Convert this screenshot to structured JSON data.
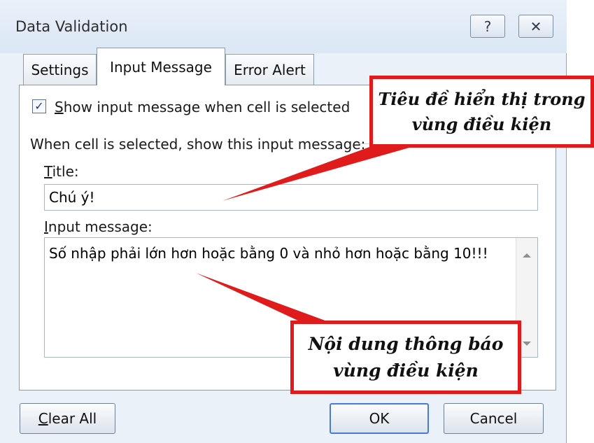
{
  "window": {
    "title": "Data Validation"
  },
  "titlebar": {
    "help_glyph": "?",
    "close_glyph": "✕"
  },
  "tabs": [
    {
      "label": "Settings",
      "active": false
    },
    {
      "label": "Input Message",
      "active": true
    },
    {
      "label": "Error Alert",
      "active": false
    }
  ],
  "settings": {
    "show_checkbox_checked": true,
    "show_checkbox_label": "Show input message when cell is selected",
    "group_label": "When cell is selected, show this input message:",
    "title_label": "Title:",
    "title_value": "Chú ý!",
    "message_label": "Input message:",
    "message_value": "Số nhập phải lớn hơn hoặc bằng 0 và nhỏ hơn hoặc bằng 10!!!"
  },
  "buttons": {
    "clear_all": "Clear All",
    "ok": "OK",
    "cancel": "Cancel"
  },
  "annotations": {
    "title_callout": "Tiêu đề hiển thị trong\nvùng điều kiện",
    "message_callout": "Nội dung thông báo\nvùng điều kiện"
  },
  "colors": {
    "callout_red": "#e01b1b",
    "dialog_bg": "#ebf1f9"
  }
}
